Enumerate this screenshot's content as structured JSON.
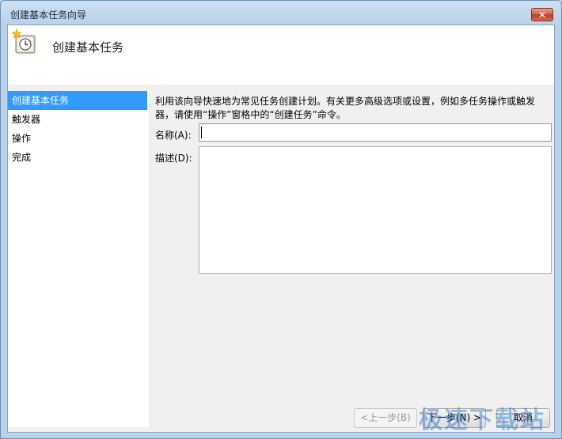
{
  "window": {
    "title": "创建基本任务向导",
    "close_symbol": "✕"
  },
  "header": {
    "title": "创建基本任务"
  },
  "nav": {
    "items": [
      {
        "label": "创建基本任务",
        "active": true
      },
      {
        "label": "触发器",
        "active": false
      },
      {
        "label": "操作",
        "active": false
      },
      {
        "label": "完成",
        "active": false
      }
    ]
  },
  "main": {
    "description": "利用该向导快速地为常见任务创建计划。有关更多高级选项或设置，例如多任务操作或触发器，请使用“操作”窗格中的“创建任务”命令。",
    "name_label": "名称(A):",
    "name_value": "",
    "desc_label": "描述(D):",
    "desc_value": ""
  },
  "buttons": {
    "back": "<上一步(B)",
    "next": "下一步(N) >",
    "cancel": "取消"
  },
  "watermark": "极速下载站",
  "icons": {
    "header": "task-scheduler-clock-icon",
    "close": "close-icon"
  },
  "colors": {
    "selection": "#3399ff",
    "close": "#c0392b"
  }
}
